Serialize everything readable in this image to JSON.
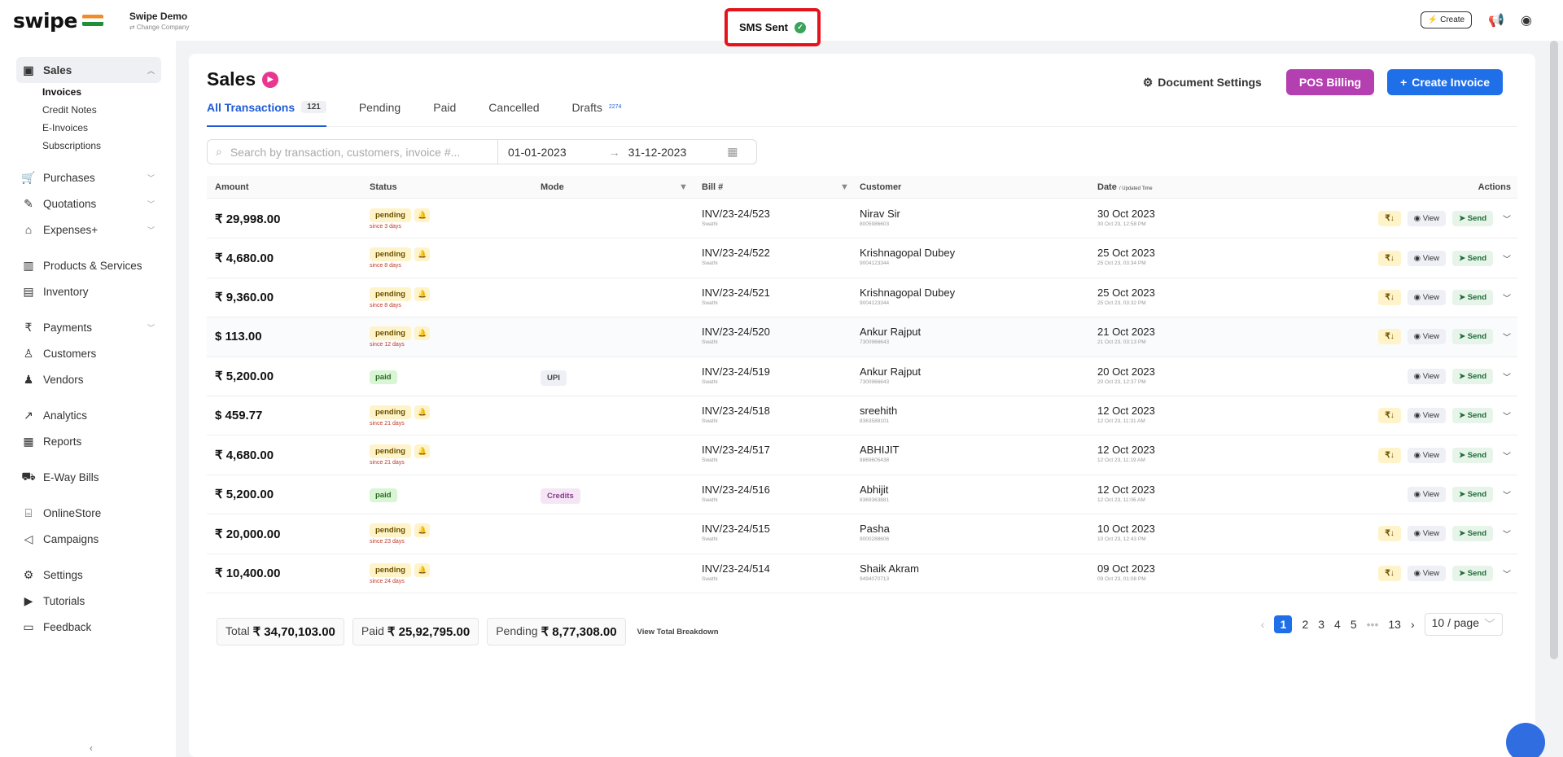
{
  "app": {
    "logo_text": "swipe",
    "company_name": "Swipe Demo",
    "change_company": "Change Company",
    "toast": "SMS Sent",
    "create_label": "Create"
  },
  "sidebar": {
    "sales": "Sales",
    "subs": [
      "Invoices",
      "Credit Notes",
      "E-Invoices",
      "Subscriptions"
    ],
    "purchases": "Purchases",
    "quotations": "Quotations",
    "expenses": "Expenses+",
    "products": "Products & Services",
    "inventory": "Inventory",
    "payments": "Payments",
    "customers": "Customers",
    "vendors": "Vendors",
    "analytics": "Analytics",
    "reports": "Reports",
    "eway": "E-Way Bills",
    "onlinestore": "OnlineStore",
    "campaigns": "Campaigns",
    "settings": "Settings",
    "tutorials": "Tutorials",
    "feedback": "Feedback"
  },
  "page": {
    "title": "Sales",
    "doc_settings": "Document Settings",
    "pos_billing": "POS Billing",
    "create_invoice": "Create Invoice",
    "tabs": [
      {
        "label": "All Transactions",
        "count": "121"
      },
      {
        "label": "Pending"
      },
      {
        "label": "Paid"
      },
      {
        "label": "Cancelled"
      },
      {
        "label": "Drafts",
        "count": "2274"
      }
    ],
    "search_placeholder": "Search by transaction, customers, invoice #...",
    "date_from": "01-01-2023",
    "date_to": "31-12-2023"
  },
  "table": {
    "headers": {
      "amount": "Amount",
      "status": "Status",
      "mode": "Mode",
      "bill": "Bill #",
      "customer": "Customer",
      "date": "Date",
      "date_sub": "/ Updated Time",
      "actions": "Actions"
    },
    "rows": [
      {
        "amount": "₹ 29,998.00",
        "status": "pending",
        "since": "since 3 days",
        "mode": "",
        "bill": "INV/23-24/523",
        "bill_sub": "Swathi",
        "customer": "Nirav Sir",
        "phone": "8005986603",
        "date": "30 Oct 2023",
        "time": "30 Oct 23, 12:58 PM",
        "pay": true,
        "view": "View",
        "send": "Send"
      },
      {
        "amount": "₹ 4,680.00",
        "status": "pending",
        "since": "since 8 days",
        "mode": "",
        "bill": "INV/23-24/522",
        "bill_sub": "Swathi",
        "customer": "Krishnagopal Dubey",
        "phone": "9004123344",
        "date": "25 Oct 2023",
        "time": "25 Oct 23, 03:34 PM",
        "pay": true,
        "view": "View",
        "send": "Send"
      },
      {
        "amount": "₹ 9,360.00",
        "status": "pending",
        "since": "since 8 days",
        "mode": "",
        "bill": "INV/23-24/521",
        "bill_sub": "Swathi",
        "customer": "Krishnagopal Dubey",
        "phone": "9004123344",
        "date": "25 Oct 2023",
        "time": "25 Oct 23, 03:32 PM",
        "pay": true,
        "view": "View",
        "send": "Send"
      },
      {
        "amount": "$ 113.00",
        "status": "pending",
        "since": "since 12 days",
        "mode": "",
        "bill": "INV/23-24/520",
        "bill_sub": "Swathi",
        "customer": "Ankur Rajput",
        "phone": "7300966643",
        "date": "21 Oct 2023",
        "time": "21 Oct 23, 03:13 PM",
        "pay": true,
        "view": "View",
        "send": "Send"
      },
      {
        "amount": "₹ 5,200.00",
        "status": "paid",
        "since": "",
        "mode": "UPI",
        "bill": "INV/23-24/519",
        "bill_sub": "Swathi",
        "customer": "Ankur Rajput",
        "phone": "7300966643",
        "date": "20 Oct 2023",
        "time": "20 Oct 23, 12:37 PM",
        "pay": false,
        "view": "View",
        "send": "Send"
      },
      {
        "amount": "$ 459.77",
        "status": "pending",
        "since": "since 21 days",
        "mode": "",
        "bill": "INV/23-24/518",
        "bill_sub": "Swathi",
        "customer": "sreehith",
        "phone": "8363588101",
        "date": "12 Oct 2023",
        "time": "12 Oct 23, 11:31 AM",
        "pay": true,
        "view": "View",
        "send": "Send"
      },
      {
        "amount": "₹ 4,680.00",
        "status": "pending",
        "since": "since 21 days",
        "mode": "",
        "bill": "INV/23-24/517",
        "bill_sub": "Swathi",
        "customer": "ABHIJIT",
        "phone": "8869605438",
        "date": "12 Oct 2023",
        "time": "12 Oct 23, 11:19 AM",
        "pay": true,
        "view": "View",
        "send": "Send"
      },
      {
        "amount": "₹ 5,200.00",
        "status": "paid",
        "since": "",
        "mode": "Credits",
        "bill": "INV/23-24/516",
        "bill_sub": "Swathi",
        "customer": "Abhijit",
        "phone": "8369363881",
        "date": "12 Oct 2023",
        "time": "12 Oct 23, 11:06 AM",
        "pay": false,
        "view": "View",
        "send": "Send"
      },
      {
        "amount": "₹ 20,000.00",
        "status": "pending",
        "since": "since 23 days",
        "mode": "",
        "bill": "INV/23-24/515",
        "bill_sub": "Swathi",
        "customer": "Pasha",
        "phone": "9000288606",
        "date": "10 Oct 2023",
        "time": "10 Oct 23, 12:43 PM",
        "pay": true,
        "view": "View",
        "send": "Send"
      },
      {
        "amount": "₹ 10,400.00",
        "status": "pending",
        "since": "since 24 days",
        "mode": "",
        "bill": "INV/23-24/514",
        "bill_sub": "Swathi",
        "customer": "Shaik Akram",
        "phone": "9494070713",
        "date": "09 Oct 2023",
        "time": "09 Oct 23, 01:08 PM",
        "pay": true,
        "view": "View",
        "send": "Send"
      }
    ]
  },
  "totals": {
    "total_label": "Total",
    "total": "₹ 34,70,103.00",
    "paid_label": "Paid",
    "paid": "₹ 25,92,795.00",
    "pending_label": "Pending",
    "pending": "₹ 8,77,308.00",
    "breakdown": "View Total Breakdown"
  },
  "pagination": {
    "pages": [
      "1",
      "2",
      "3",
      "4",
      "5"
    ],
    "ellipsis": "•••",
    "last": "13",
    "page_size": "10 / page"
  }
}
